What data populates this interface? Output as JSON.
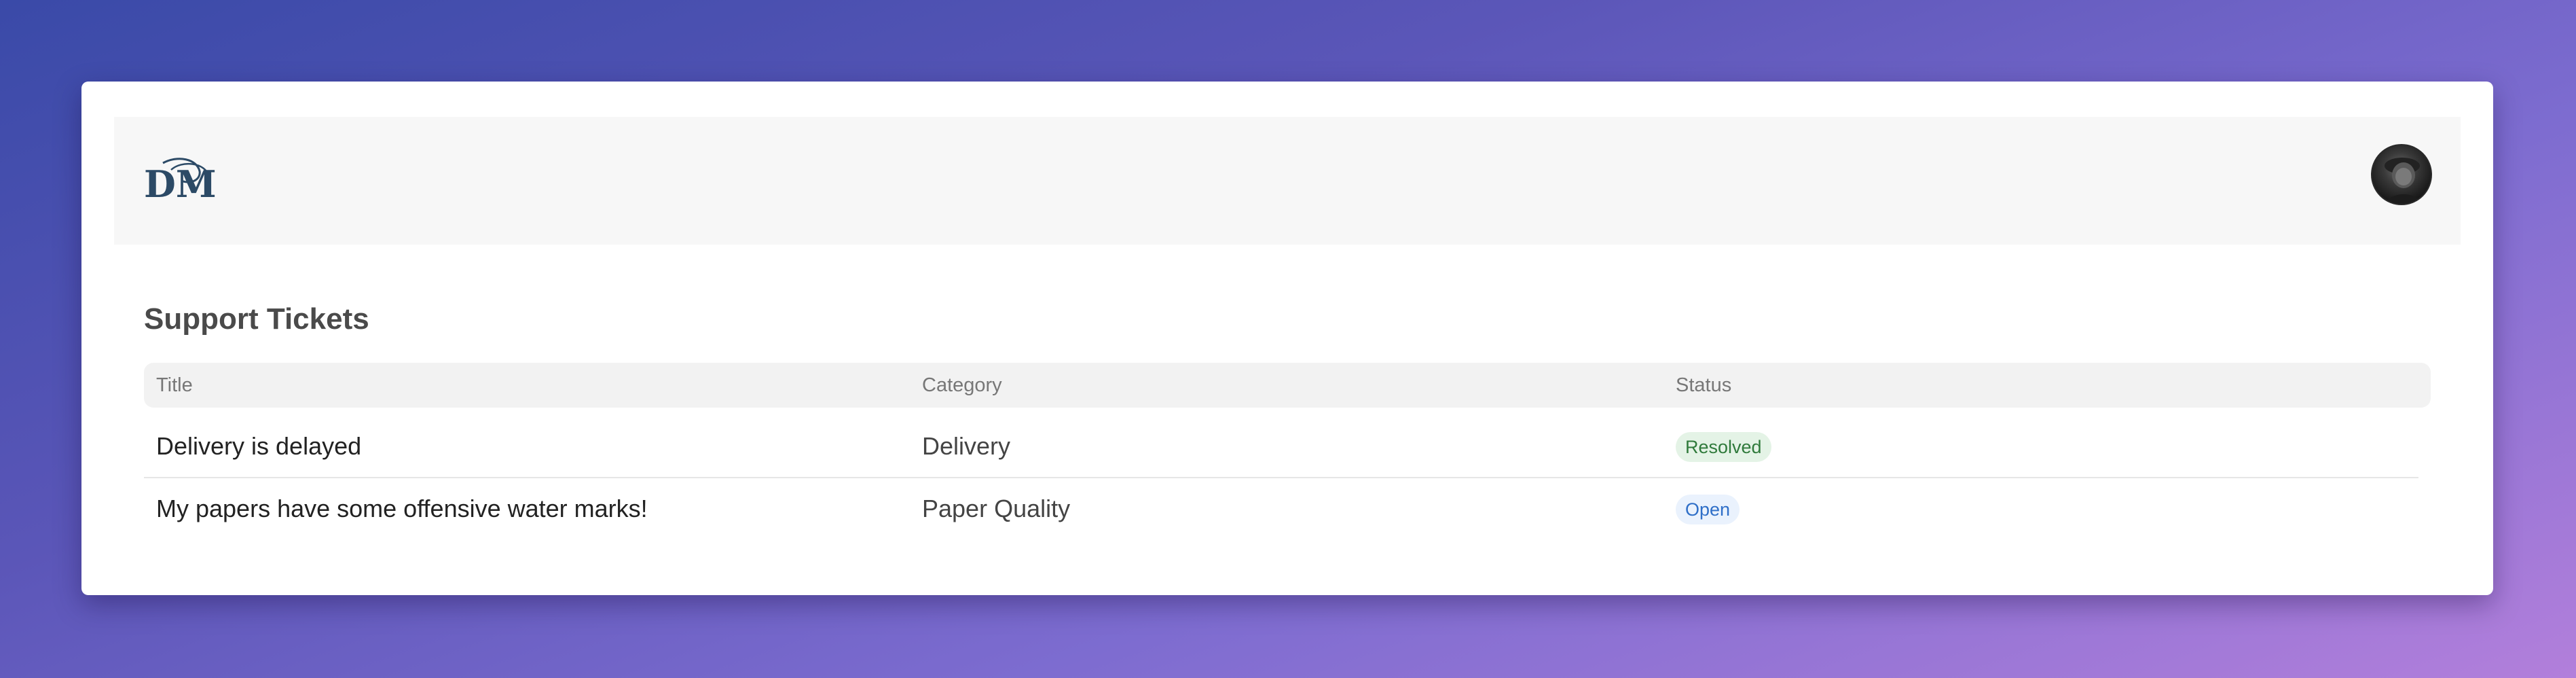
{
  "header": {
    "logo_text": "DM",
    "avatar_alt": "User avatar"
  },
  "page": {
    "title": "Support Tickets"
  },
  "table": {
    "columns": [
      "Title",
      "Category",
      "Status"
    ],
    "rows": [
      {
        "title": "Delivery is delayed",
        "category": "Delivery",
        "status": "Resolved"
      },
      {
        "title": "My papers have some offensive water marks!",
        "category": "Paper Quality",
        "status": "Open"
      }
    ]
  },
  "colors": {
    "logo": "#2c4a66",
    "resolved_bg": "#e4f3e6",
    "resolved_text": "#2f7a3b",
    "open_bg": "#eaf2fd",
    "open_text": "#2f6fc8"
  }
}
